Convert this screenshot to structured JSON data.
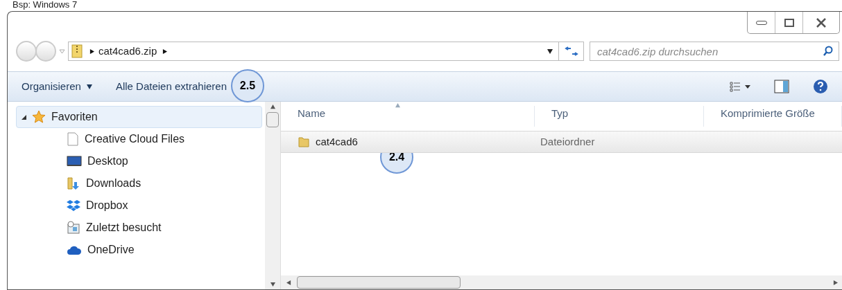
{
  "caption": "Bsp: Windows 7",
  "address": {
    "breadcrumb": [
      "cat4cad6.zip"
    ]
  },
  "search": {
    "placeholder": "cat4cad6.zip durchsuchen"
  },
  "toolbar": {
    "items": [
      {
        "label": "Organisieren",
        "kind": "dropdown"
      },
      {
        "label": "Alle Dateien extrahieren",
        "kind": "button",
        "callout": "2.5"
      }
    ]
  },
  "sidebar": {
    "items": [
      {
        "label": "Favoriten",
        "kind": "favorites",
        "selected": true,
        "expanded": true,
        "children": [
          {
            "label": "Creative Cloud Files",
            "kind": "document",
            "selected": false
          },
          {
            "label": "Desktop",
            "kind": "desktop",
            "selected": false
          },
          {
            "label": "Downloads",
            "kind": "downloads",
            "selected": false
          },
          {
            "label": "Dropbox",
            "kind": "dropbox",
            "selected": false
          },
          {
            "label": "Zuletzt besucht",
            "kind": "recent",
            "selected": false
          },
          {
            "label": "OneDrive",
            "kind": "cloud",
            "selected": false
          }
        ]
      }
    ]
  },
  "table": {
    "columns": [
      "Name",
      "Typ",
      "Komprimierte Größe"
    ],
    "rows": [
      {
        "name": "cat4cad6",
        "type": "Dateiordner",
        "selected": true,
        "callout": "2.4"
      }
    ]
  }
}
